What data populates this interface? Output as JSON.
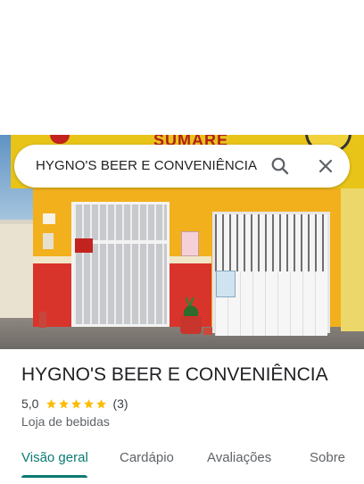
{
  "search": {
    "query": "HYGNO'S BEER E CONVENIÊNCIA",
    "search_icon": "search-icon",
    "close_icon": "close-icon"
  },
  "photo": {
    "sign_text": "SUMARE"
  },
  "place": {
    "name": "HYGNO'S BEER E CONVENIÊNCIA",
    "rating": "5,0",
    "stars": 5,
    "review_count": "(3)",
    "category": "Loja de bebidas"
  },
  "tabs": [
    {
      "label": "Visão geral",
      "active": true
    },
    {
      "label": "Cardápio",
      "active": false
    },
    {
      "label": "Avaliações",
      "active": false
    },
    {
      "label": "Sobre",
      "active": false
    }
  ],
  "colors": {
    "accent": "#0b7a73",
    "star": "#fbbc04",
    "text_primary": "#202124",
    "text_secondary": "#5f6368"
  }
}
